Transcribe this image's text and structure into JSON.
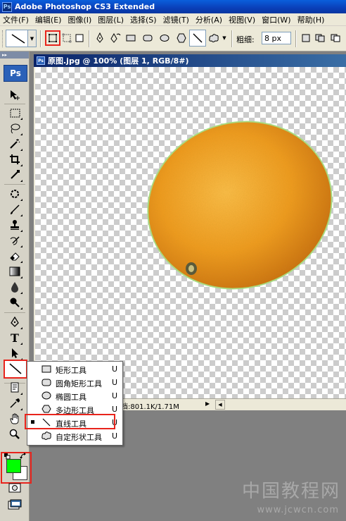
{
  "app": {
    "title": "Adobe Photoshop CS3 Extended",
    "icon_text": "Ps"
  },
  "menu": [
    "文件(F)",
    "编辑(E)",
    "图像(I)",
    "图层(L)",
    "选择(S)",
    "滤镜(T)",
    "分析(A)",
    "视图(V)",
    "窗口(W)",
    "帮助(H)"
  ],
  "options": {
    "weight_label": "粗细:",
    "weight_value": "8 px"
  },
  "toolbox": {
    "logo": "Ps",
    "active_tool": "line-tool",
    "foreground_color": "#00ff00",
    "background_color": "#ffffff"
  },
  "document": {
    "title": "原图.jpg @ 100% (图层 1, RGB/8#)",
    "status": "档:801.1K/1.71M"
  },
  "flyout": {
    "items": [
      {
        "label": "矩形工具",
        "key": "U",
        "icon": "rectangle-icon",
        "selected": false
      },
      {
        "label": "圆角矩形工具",
        "key": "U",
        "icon": "rounded-rectangle-icon",
        "selected": false
      },
      {
        "label": "椭圆工具",
        "key": "U",
        "icon": "ellipse-icon",
        "selected": false
      },
      {
        "label": "多边形工具",
        "key": "U",
        "icon": "polygon-icon",
        "selected": false
      },
      {
        "label": "直线工具",
        "key": "U",
        "icon": "line-icon",
        "selected": true
      },
      {
        "label": "自定形状工具",
        "key": "U",
        "icon": "custom-shape-icon",
        "selected": false
      }
    ]
  },
  "watermark": {
    "text": "中国教程网",
    "url": "www.jcwcn.com"
  },
  "colors": {
    "highlight_red": "#e8241c",
    "orange": "#f29a1c"
  }
}
